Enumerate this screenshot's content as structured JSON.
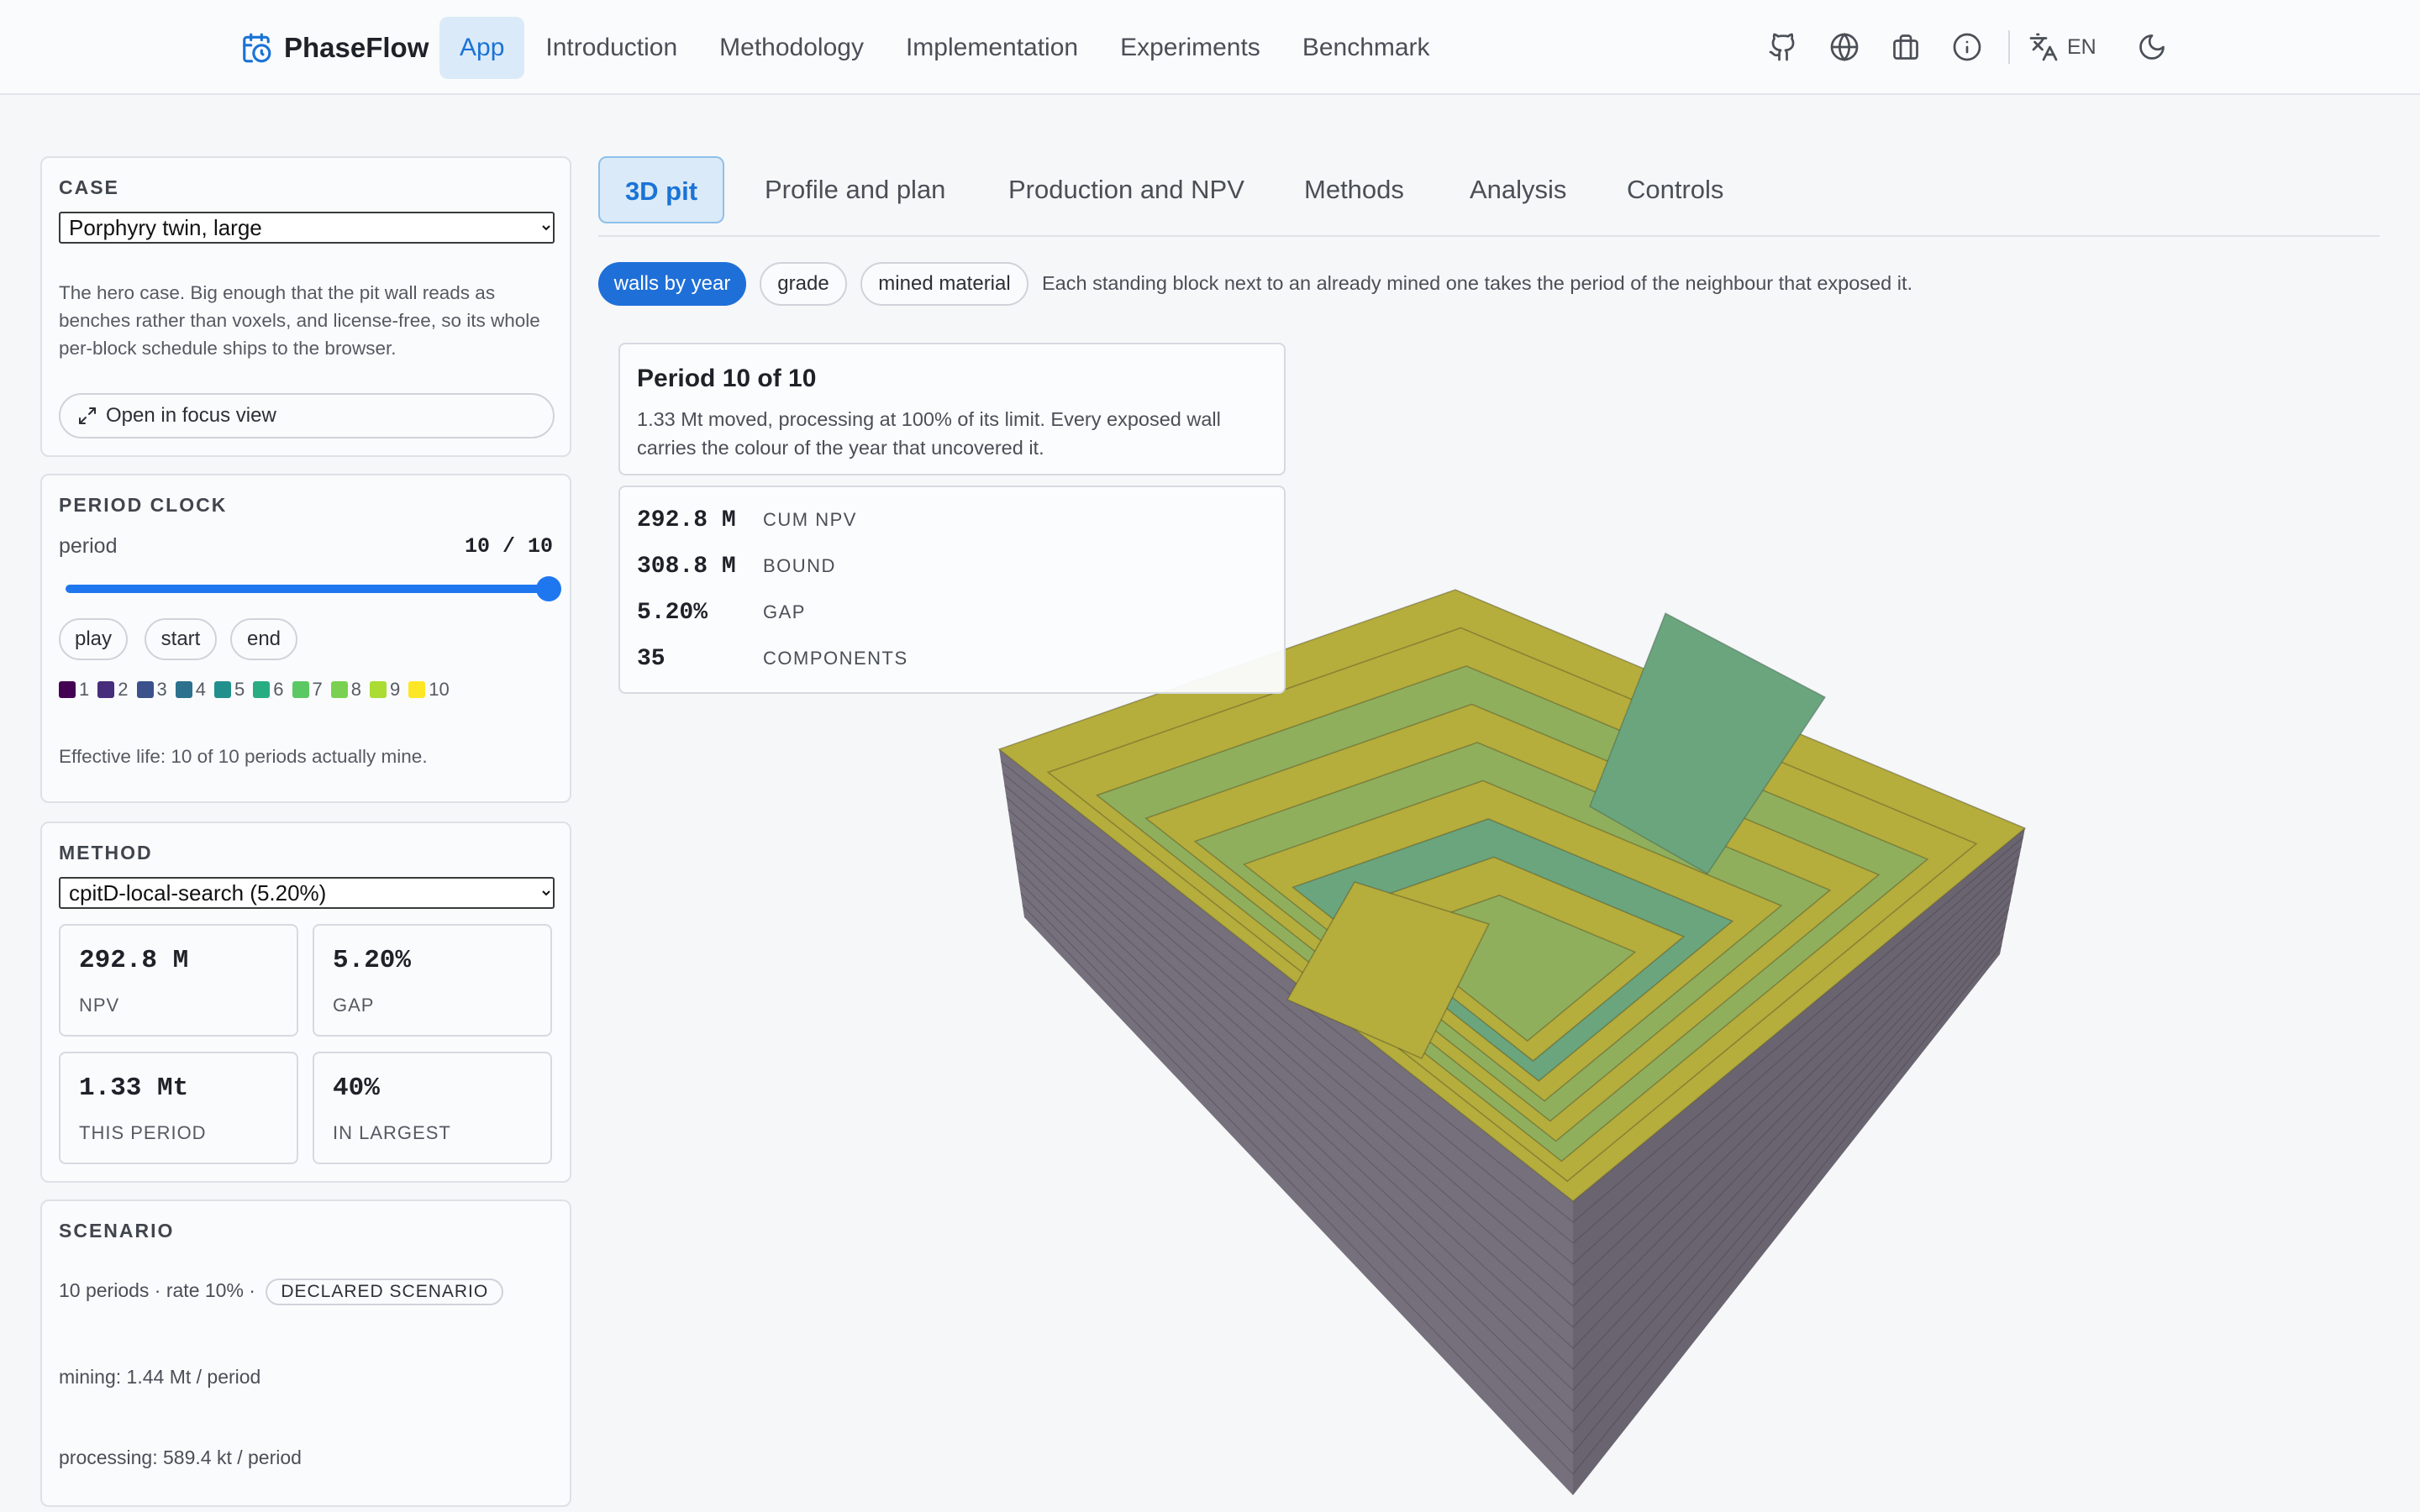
{
  "brand": {
    "name": "PhaseFlow",
    "icon": "calendar-clock-icon"
  },
  "nav": {
    "items": [
      {
        "label": "App",
        "active": true
      },
      {
        "label": "Introduction"
      },
      {
        "label": "Methodology"
      },
      {
        "label": "Implementation"
      },
      {
        "label": "Experiments"
      },
      {
        "label": "Benchmark"
      }
    ],
    "icons": [
      "github-icon",
      "globe-icon",
      "briefcase-icon",
      "info-icon"
    ],
    "language": "EN"
  },
  "case": {
    "title": "CASE",
    "selected": "Porphyry twin, large",
    "description": "The hero case. Big enough that the pit wall reads as benches rather than voxels, and license-free, so its whole per-block schedule ships to the browser.",
    "focus_button": "Open in focus view"
  },
  "clock": {
    "title": "PERIOD CLOCK",
    "label": "period",
    "value_text": "10 / 10",
    "value": 10,
    "max": 10,
    "buttons": [
      "play",
      "start",
      "end"
    ],
    "legend": [
      {
        "label": "1",
        "color": "#440154"
      },
      {
        "label": "2",
        "color": "#472d7b"
      },
      {
        "label": "3",
        "color": "#3b518b"
      },
      {
        "label": "4",
        "color": "#2c718e"
      },
      {
        "label": "5",
        "color": "#21908d"
      },
      {
        "label": "6",
        "color": "#27ad81"
      },
      {
        "label": "7",
        "color": "#5cc863"
      },
      {
        "label": "8",
        "color": "#7ad151"
      },
      {
        "label": "9",
        "color": "#aadc32"
      },
      {
        "label": "10",
        "color": "#fde725"
      }
    ],
    "effective_life": "Effective life: 10 of 10 periods actually mine."
  },
  "method": {
    "title": "METHOD",
    "selected": "cpitD-local-search (5.20%)",
    "metrics": [
      {
        "value": "292.8 M",
        "label": "NPV"
      },
      {
        "value": "5.20%",
        "label": "GAP"
      },
      {
        "value": "1.33 Mt",
        "label": "THIS PERIOD"
      },
      {
        "value": "40%",
        "label": "IN LARGEST"
      }
    ]
  },
  "scenario": {
    "title": "SCENARIO",
    "summary": "10 periods · rate 10% ·",
    "badge": "DECLARED SCENARIO",
    "mining": "mining: 1.44 Mt / period",
    "processing": "processing: 589.4 kt / period"
  },
  "tabs": [
    {
      "label": "3D pit",
      "active": true
    },
    {
      "label": "Profile and plan"
    },
    {
      "label": "Production and NPV"
    },
    {
      "label": "Methods"
    },
    {
      "label": "Analysis"
    },
    {
      "label": "Controls"
    }
  ],
  "view_modes": [
    {
      "label": "walls by year",
      "active": true
    },
    {
      "label": "grade"
    },
    {
      "label": "mined material"
    }
  ],
  "view_description": "Each standing block next to an already mined one takes the period of the neighbour that exposed it.",
  "info": {
    "title": "Period 10 of 10",
    "text": "1.33 Mt moved, processing at 100% of its limit. Every exposed wall carries the colour of the year that uncovered it."
  },
  "stats": [
    {
      "value": "292.8 M",
      "label": "CUM NPV"
    },
    {
      "value": "308.8 M",
      "label": "BOUND"
    },
    {
      "value": "5.20%",
      "label": "GAP"
    },
    {
      "value": "35",
      "label": "COMPONENTS"
    }
  ],
  "pit_colors": {
    "wall_side": "#76707c",
    "wall_front": "#6a6470",
    "bench_yellow": "#b5ad3c",
    "bench_green": "#8faf5c",
    "bench_teal": "#6aa57d"
  }
}
